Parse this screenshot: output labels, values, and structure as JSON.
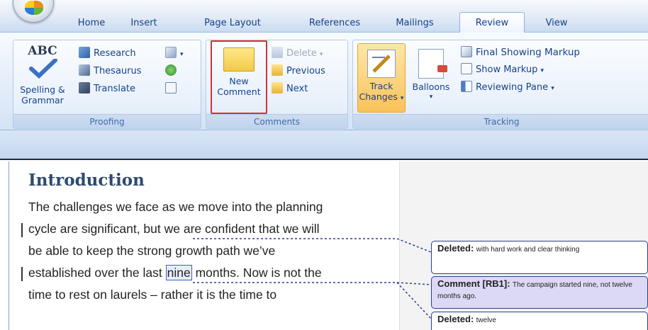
{
  "tabs": [
    "Home",
    "Insert",
    "Page Layout",
    "References",
    "Mailings",
    "Review",
    "View"
  ],
  "active_tab": "Review",
  "proofing": {
    "spelling_label_1": "Spelling &",
    "spelling_label_2": "Grammar",
    "research": "Research",
    "thesaurus": "Thesaurus",
    "translate": "Translate",
    "group_label": "Proofing"
  },
  "comments": {
    "new_comment_1": "New",
    "new_comment_2": "Comment",
    "delete": "Delete",
    "previous": "Previous",
    "next": "Next",
    "group_label": "Comments"
  },
  "tracking": {
    "track_changes_1": "Track",
    "track_changes_2": "Changes",
    "balloons": "Balloons",
    "display_for_review": "Final Showing Markup",
    "show_markup": "Show Markup",
    "reviewing_pane": "Reviewing Pane",
    "group_label": "Tracking"
  },
  "document": {
    "title": "Introduction",
    "line1": "The challenges we face as we move into the planning",
    "line2_a": "cycle are significant, but",
    "line2_b": "we are confident that we will",
    "line3": "be able to keep the strong growth path we’ve",
    "line4_a": "established over the last",
    "line4_hl": "nine",
    "line4_b": "months.  Now is not the",
    "line5": "time to rest on laurels – rather it is the time to"
  },
  "balloons": [
    {
      "kind": "deleted",
      "label": "Deleted:",
      "text": "with hard work and clear thinking"
    },
    {
      "kind": "comment",
      "label": "Comment [RB1]:",
      "text": "The campaign started nine,  not twelve months ago."
    },
    {
      "kind": "deleted",
      "label": "Deleted:",
      "text": "twelve"
    }
  ]
}
